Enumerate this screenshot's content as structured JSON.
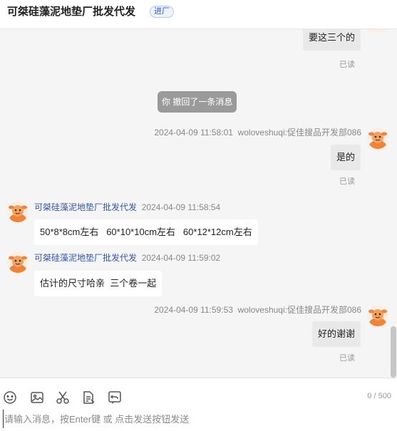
{
  "header": {
    "title": "可桀硅藻泥地垫厂批发代发",
    "tag": "进厂"
  },
  "messages": [
    {
      "text": "要这三个的",
      "read_status": "已读"
    },
    {
      "system_notice": "你 撤回了一条消息"
    },
    {
      "time": "2024-04-09 11:58:01",
      "sender": "woloveshuqi:促佳搜品开发部086",
      "text": "是的",
      "read_status": "已读"
    },
    {
      "sender": "可桀硅藻泥地垫厂批发代发",
      "time": "2024-04-09 11:58:54",
      "text": "50*8*8cm左右   60*10*10cm左右   60*12*12cm左右"
    },
    {
      "sender": "可桀硅藻泥地垫厂批发代发",
      "time": "2024-04-09 11:59:02",
      "text": "估计的尺寸哈亲  三个卷一起"
    },
    {
      "time": "2024-04-09 11:59:53",
      "sender": "woloveshuqi:促佳搜品开发部086",
      "text": "好的谢谢",
      "read_status": "已读"
    }
  ],
  "composer": {
    "counter": "0 / 500",
    "placeholder": "请输入消息，按Enter键 或 点击发送按钮发送",
    "tools": [
      "emoji-icon",
      "image-icon",
      "scissors-icon",
      "document-icon",
      "undo-icon"
    ]
  },
  "colors": {
    "outgoing_bubble": "#e9e9e9",
    "incoming_bubble": "#ffffff",
    "chat_bg": "#f5f5f5",
    "sender_name": "#3556b8",
    "system_notice": "#9a9a9a"
  }
}
